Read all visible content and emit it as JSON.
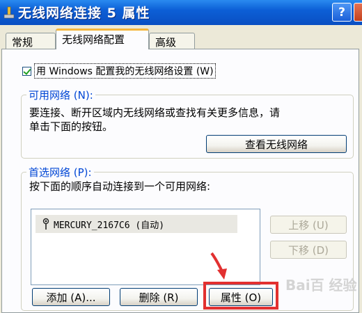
{
  "window": {
    "title": "无线网络连接 5 属性",
    "help_glyph": "?"
  },
  "tabs": [
    {
      "label": "常规",
      "active": false
    },
    {
      "label": "无线网络配置",
      "active": true
    },
    {
      "label": "高级",
      "active": false
    }
  ],
  "checkbox": {
    "label": "用 Windows 配置我的无线网络设置 (W)",
    "checked": true
  },
  "available": {
    "title": "可用网络 (N):",
    "description_line1": "要连接、断开区域内无线网络或查找有关更多信息，请",
    "description_line2": "单击下面的按钮。",
    "view_button": "查看无线网络"
  },
  "preferred": {
    "title": "首选网络 (P):",
    "description": "按下面的顺序自动连接到一个可用网络:",
    "networks": [
      {
        "name": "MERCURY_2167C6 (自动)"
      }
    ],
    "move_up": "上移 (U)",
    "move_down": "下移 (D)",
    "add": "添加 (A)...",
    "remove": "删除 (R)",
    "properties": "属性 (O)"
  },
  "watermark": "Bai百 经验",
  "colors": {
    "title_bar": "#0a4fc2",
    "highlight_box": "#e23030",
    "group_title": "#0046d5"
  }
}
